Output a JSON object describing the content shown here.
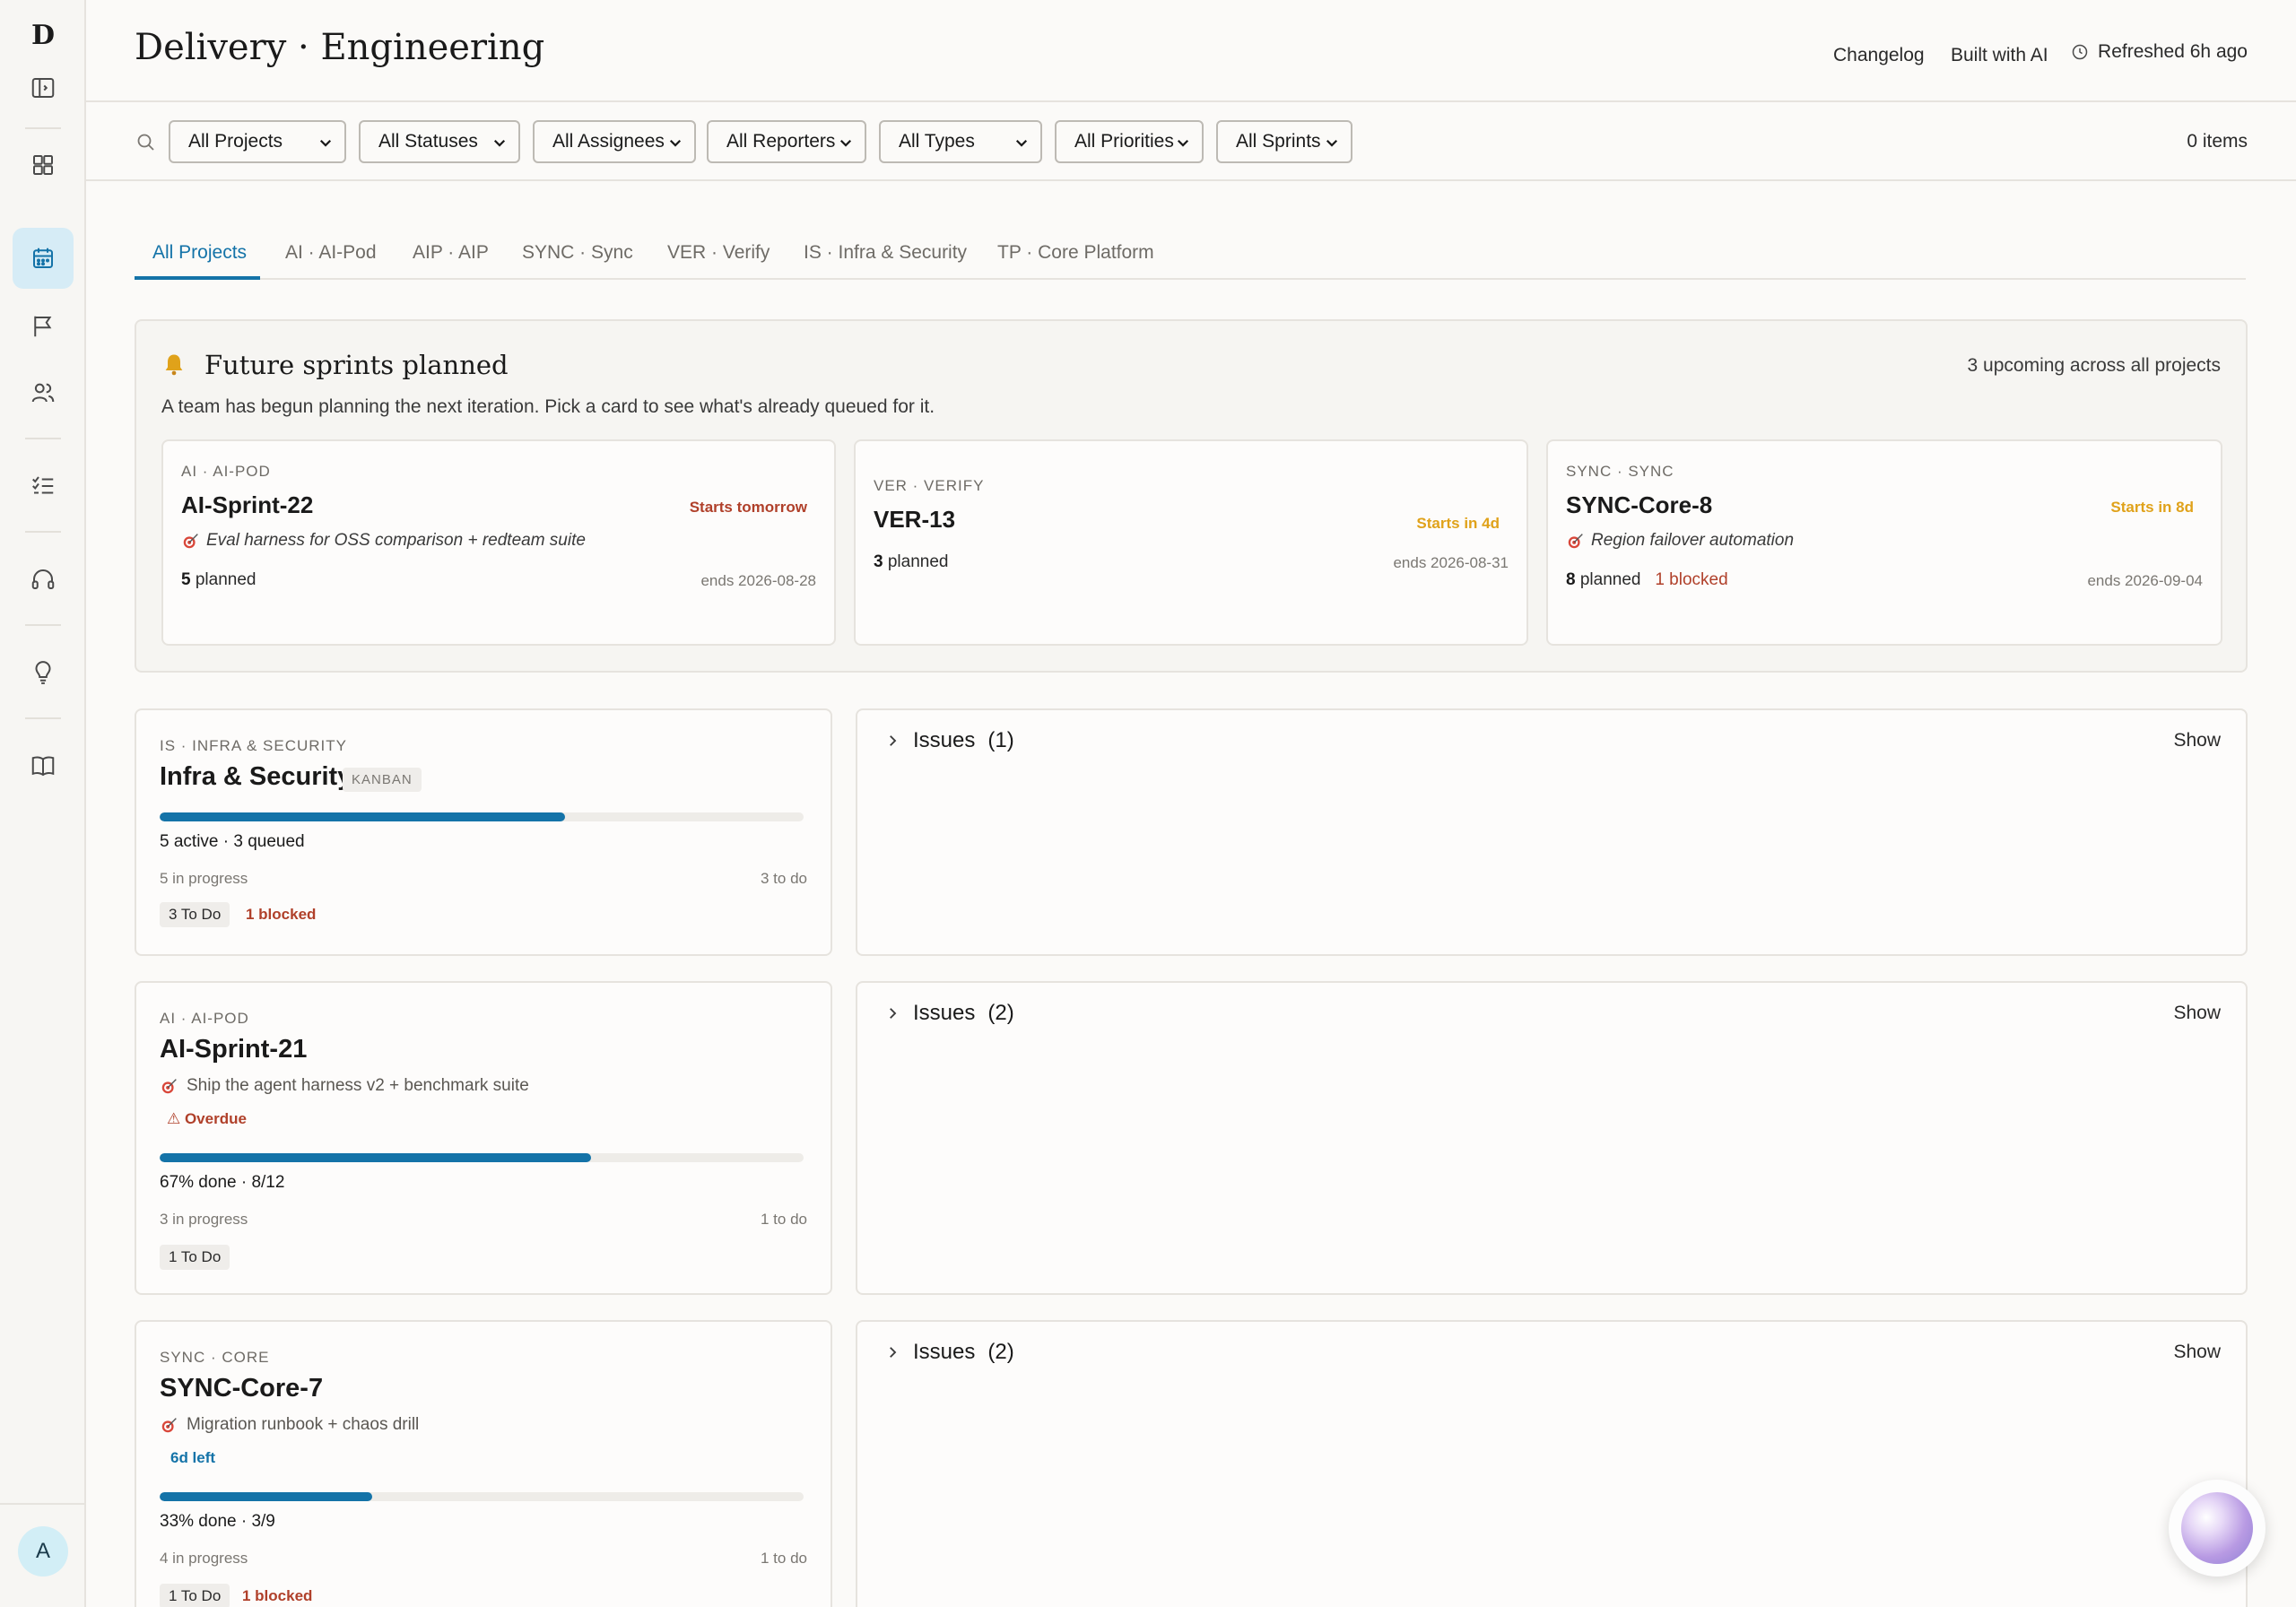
{
  "app": {
    "logo": "D",
    "avatar": "A"
  },
  "header": {
    "title": "Delivery · Engineering",
    "changelog": "Changelog",
    "built_with": "Built with AI",
    "refreshed": "Refreshed 6h ago"
  },
  "filters": {
    "projects": "All Projects",
    "statuses": "All Statuses",
    "assignees": "All Assignees",
    "reporters": "All Reporters",
    "types": "All Types",
    "priorities": "All Priorities",
    "sprints": "All Sprints",
    "count": "0 items"
  },
  "tabs": [
    {
      "label": "All Projects"
    },
    {
      "label": "AI · AI-Pod"
    },
    {
      "label": "AIP · AIP"
    },
    {
      "label": "SYNC · Sync"
    },
    {
      "label": "VER · Verify"
    },
    {
      "label": "IS · Infra & Security"
    },
    {
      "label": "TP · Core Platform"
    }
  ],
  "future": {
    "title": "Future sprints planned",
    "subtitle": "A team has begun planning the next iteration. Pick a card to see what's already queued for it.",
    "count": "3 upcoming across all projects",
    "cards": [
      {
        "project": "AI · AI-POD",
        "name": "AI-Sprint-22",
        "starts": "Starts tomorrow",
        "starts_color": "#b0402a",
        "goal": "Eval harness for OSS comparison + redteam suite",
        "planned_num": "5",
        "planned_label": "planned",
        "blocked": "",
        "ends": "ends 2026-08-28"
      },
      {
        "project": "VER · VERIFY",
        "name": "VER-13",
        "starts": "Starts in 4d",
        "starts_color": "#e0a21a",
        "goal": "",
        "planned_num": "3",
        "planned_label": "planned",
        "blocked": "",
        "ends": "ends 2026-08-31"
      },
      {
        "project": "SYNC · SYNC",
        "name": "SYNC-Core-8",
        "starts": "Starts in 8d",
        "starts_color": "#e0a21a",
        "goal": "Region failover automation",
        "planned_num": "8",
        "planned_label": "planned",
        "blocked": "1 blocked",
        "ends": "ends 2026-09-04"
      }
    ]
  },
  "sprints": [
    {
      "project": "IS · INFRA & SECURITY",
      "name": "Infra & Security",
      "badge": "KANBAN",
      "progress": 0.63,
      "summary": "5 active · 3 queued",
      "in_progress": "5 in progress",
      "to_do": "3 to do",
      "tag": "3 To Do",
      "blocked": "1 blocked",
      "issues_label": "Issues",
      "issues_count": "(1)",
      "show": "Show"
    },
    {
      "project": "AI · AI-POD",
      "name": "AI-Sprint-21",
      "goal": "Ship the agent harness v2 + benchmark suite",
      "status": "⚠ Overdue",
      "progress": 0.67,
      "summary": "67% done · 8/12",
      "in_progress": "3 in progress",
      "to_do": "1 to do",
      "tag": "1 To Do",
      "issues_label": "Issues",
      "issues_count": "(2)",
      "show": "Show"
    },
    {
      "project": "SYNC · CORE",
      "name": "SYNC-Core-7",
      "goal": "Migration runbook + chaos drill",
      "status": "6d left",
      "progress": 0.33,
      "summary": "33% done · 3/9",
      "in_progress": "4 in progress",
      "to_do": "1 to do",
      "tag": "1 To Do",
      "blocked": "1 blocked",
      "issues_label": "Issues",
      "issues_count": "(2)",
      "show": "Show"
    }
  ],
  "colors": {
    "accent": "#1473a8",
    "blocked": "#b0402a",
    "warning": "#e0a21a",
    "active_nav": "#d6ecf6"
  },
  "icons": [
    "sidebar-toggle-icon",
    "grid-icon",
    "calendar-icon",
    "flag-icon",
    "users-icon",
    "checklist-icon",
    "headphones-icon",
    "lightbulb-icon",
    "book-icon",
    "clock-icon",
    "search-icon",
    "chevron-down-icon",
    "chevron-right-icon",
    "bell-icon",
    "target-icon"
  ]
}
